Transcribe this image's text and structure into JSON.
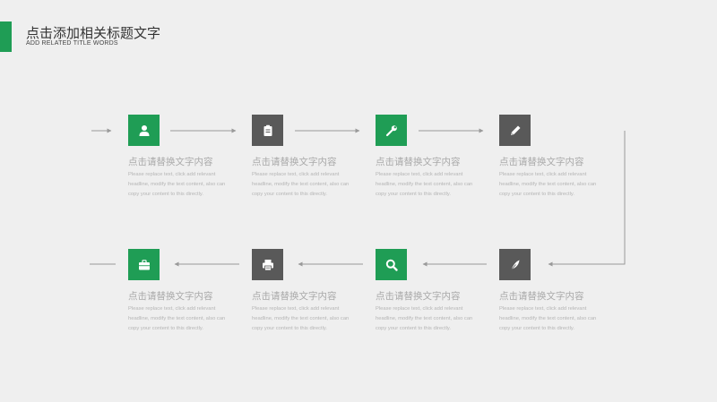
{
  "header": {
    "title": "点击添加相关标题文字",
    "subtitle": "ADD RELATED TITLE WORDS",
    "accent_color": "#1f9d55"
  },
  "colors": {
    "green": "#1f9d55",
    "gray": "#595959",
    "line": "#9a9a9a"
  },
  "steps": [
    {
      "icon": "user-icon",
      "color": "green",
      "title": "点击请替换文字内容",
      "desc": "Please replace text, click add relevant headline, modify the text content, also can copy your content to this directly."
    },
    {
      "icon": "clipboard-icon",
      "color": "gray",
      "title": "点击请替换文字内容",
      "desc": "Please replace text, click add relevant headline, modify the text content, also can copy your content to this directly."
    },
    {
      "icon": "wrench-icon",
      "color": "green",
      "title": "点击请替换文字内容",
      "desc": "Please replace text, click add relevant headline, modify the text content, also can copy your content to this directly."
    },
    {
      "icon": "pencil-icon",
      "color": "gray",
      "title": "点击请替换文字内容",
      "desc": "Please replace text, click add relevant headline, modify the text content, also can copy your content to this directly."
    },
    {
      "icon": "briefcase-icon",
      "color": "green",
      "title": "点击请替换文字内容",
      "desc": "Please replace text, click add relevant headline, modify the text content, also can copy your content to this directly."
    },
    {
      "icon": "printer-icon",
      "color": "gray",
      "title": "点击请替换文字内容",
      "desc": "Please replace text, click add relevant headline, modify the text content, also can copy your content to this directly."
    },
    {
      "icon": "search-icon",
      "color": "green",
      "title": "点击请替换文字内容",
      "desc": "Please replace text, click add relevant headline, modify the text content, also can copy your content to this directly."
    },
    {
      "icon": "feather-icon",
      "color": "gray",
      "title": "点击请替换文字内容",
      "desc": "Please replace text, click add relevant headline, modify the text content, also can copy your content to this directly."
    }
  ]
}
